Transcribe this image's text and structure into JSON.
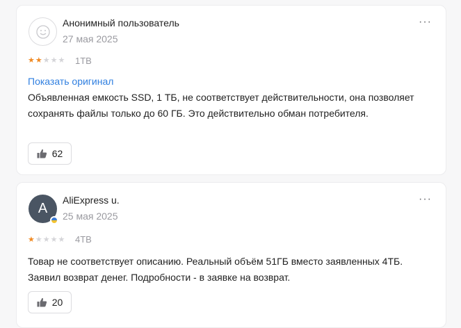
{
  "colors": {
    "star_filled": "#f08a24",
    "star_empty": "#d4d4d8",
    "link": "#2f7fe0",
    "avatar_bg": "#4a5563"
  },
  "reviews": [
    {
      "author": "Анонимный пользователь",
      "avatar": "smiley-icon",
      "date": "27 мая 2025",
      "rating": 2,
      "variant": "1TB",
      "show_original": "Показать оригинал",
      "text": "Объявленная емкость SSD, 1 ТБ, не соответствует действительности, она позволяет сохранять файлы только до 60 ГБ. Это действительно обман потребителя.",
      "likes": "62",
      "more": "···"
    },
    {
      "author": "AliExpress u.",
      "avatar_letter": "A",
      "date": "25 мая 2025",
      "rating": 1,
      "variant": "4TB",
      "text": "Товар не соответствует описанию. Реальный объём 51ГБ вместо заявленных 4ТБ. Заявил возврат денег. Подробности - в заявке на возврат.",
      "likes": "20",
      "more": "···"
    }
  ]
}
